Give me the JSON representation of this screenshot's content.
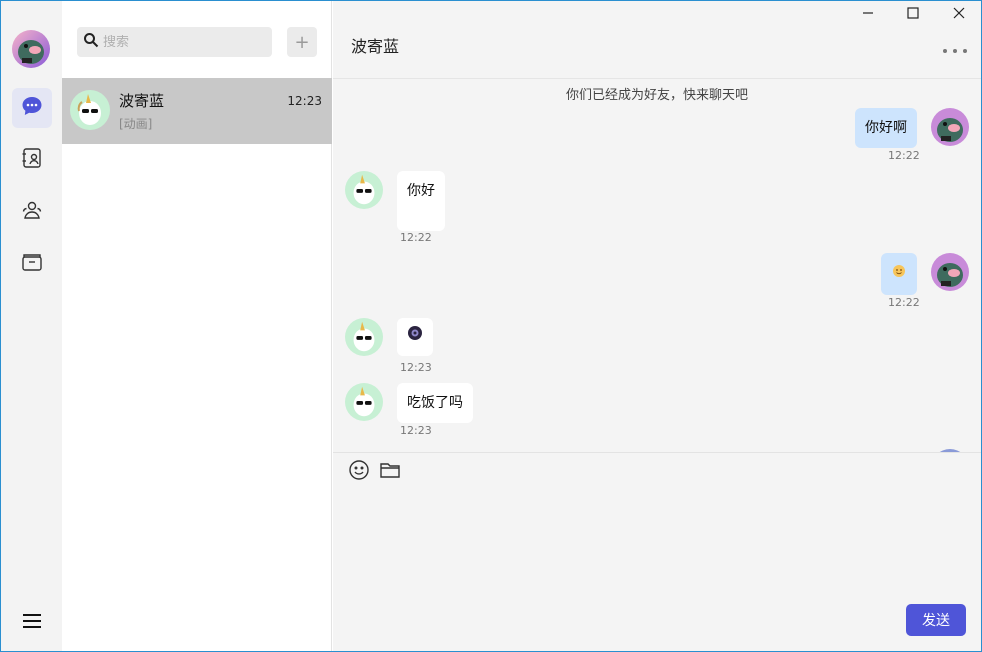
{
  "rail": {
    "my_avatar": "dinosaur-avatar",
    "items": [
      {
        "name": "chat-icon",
        "active": true
      },
      {
        "name": "contacts-book-icon",
        "active": false
      },
      {
        "name": "group-icon",
        "active": false
      },
      {
        "name": "folder-icon",
        "active": false
      }
    ],
    "menu_icon": "hamburger-menu-icon"
  },
  "sessions": {
    "search_placeholder": "搜索",
    "add_label": "+",
    "items": [
      {
        "name": "波寄蓝",
        "preview": "[动画]",
        "time": "12:23",
        "avatar": "unicorn-avatar"
      }
    ]
  },
  "chat": {
    "title": "波寄蓝",
    "system_tip": "你们已经成为好友，快来聊天吧",
    "messages": [
      {
        "side": "right",
        "text": "你好啊",
        "time": "12:22"
      },
      {
        "side": "left",
        "text": "你好",
        "time": "12:22"
      },
      {
        "side": "right",
        "text": "",
        "sticker": "smile-emoji",
        "time": "12:22"
      },
      {
        "side": "left",
        "text": "",
        "sticker": "animated-sticker",
        "time": "12:23"
      },
      {
        "side": "left",
        "text": "吃饭了吗",
        "time": "12:23"
      }
    ],
    "send_label": "发送"
  },
  "colors": {
    "accent": "#4f55d8",
    "bubble_self": "#cde4fd",
    "bubble_other": "#ffffff",
    "session_selected": "#c8c8c8"
  }
}
